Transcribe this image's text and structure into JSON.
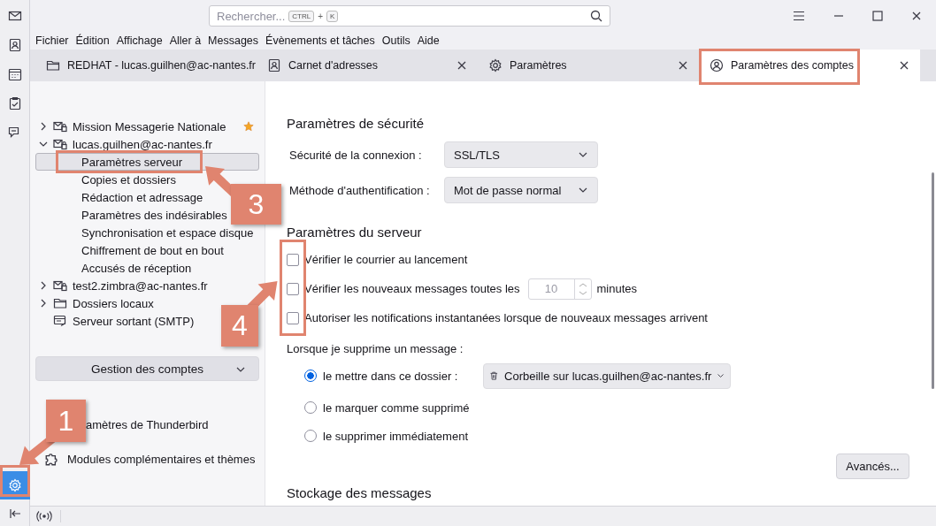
{
  "search": {
    "placeholder": "Rechercher...",
    "keys": [
      "CTRL",
      "+",
      "K"
    ]
  },
  "menu": [
    "Fichier",
    "Édition",
    "Affichage",
    "Aller à",
    "Messages",
    "Évènements et tâches",
    "Outils",
    "Aide"
  ],
  "tabs": [
    {
      "label": "REDHAT - lucas.guilhen@ac-nantes.fr",
      "kind": "folder",
      "closable": false,
      "selected": false
    },
    {
      "label": "Carnet d'adresses",
      "kind": "contacts",
      "closable": true,
      "selected": false
    },
    {
      "label": "Paramètres",
      "kind": "settings",
      "closable": true,
      "selected": false
    },
    {
      "label": "Paramètres des comptes",
      "kind": "account",
      "closable": true,
      "selected": true
    }
  ],
  "accounts": [
    {
      "label": "Mission Messagerie Nationale",
      "kind": "mail",
      "expanded": false,
      "starred": true
    },
    {
      "label": "lucas.guilhen@ac-nantes.fr",
      "kind": "mail",
      "expanded": true,
      "starred": false,
      "children": [
        {
          "label": "Paramètres serveur",
          "selected": true
        },
        {
          "label": "Copies et dossiers",
          "selected": false
        },
        {
          "label": "Rédaction et adressage",
          "selected": false
        },
        {
          "label": "Paramètres des indésirables",
          "selected": false
        },
        {
          "label": "Synchronisation et espace disque",
          "selected": false
        },
        {
          "label": "Chiffrement de bout en bout",
          "selected": false
        },
        {
          "label": "Accusés de réception",
          "selected": false
        }
      ]
    },
    {
      "label": "test2.zimbra@ac-nantes.fr",
      "kind": "mail",
      "expanded": false,
      "starred": false
    },
    {
      "label": "Dossiers locaux",
      "kind": "local",
      "expanded": false,
      "starred": false
    },
    {
      "label": "Serveur sortant (SMTP)",
      "kind": "smtp",
      "starred": false
    }
  ],
  "account_actions": "Gestion des comptes",
  "footer_links": [
    {
      "label": "amètres de Thunderbird",
      "kind": "covered"
    },
    {
      "label": "Modules complémentaires et thèmes",
      "kind": "addons"
    }
  ],
  "security": {
    "title": "Paramètres de sécurité",
    "fields": [
      {
        "label": "Sécurité de la connexion :",
        "value": "SSL/TLS"
      },
      {
        "label": "Méthode d'authentification :",
        "value": "Mot de passe normal"
      }
    ]
  },
  "server": {
    "title": "Paramètres du serveur",
    "options": [
      {
        "label": "Vérifier le courrier au lancement",
        "checked": false
      },
      {
        "label": "Vérifier les nouveaux messages toutes les",
        "checked": false,
        "interval": "10",
        "unit": "minutes"
      },
      {
        "label": "Autoriser les notifications instantanées lorsque de nouveaux messages arrivent",
        "checked": false
      }
    ]
  },
  "delete": {
    "label": "Lorsque je supprime un message :",
    "choices": [
      {
        "label": "le mettre dans ce dossier :",
        "selected": true,
        "folder": "Corbeille sur lucas.guilhen@ac-nantes.fr"
      },
      {
        "label": "le marquer comme supprimé",
        "selected": false
      },
      {
        "label": "le supprimer immédiatement",
        "selected": false
      }
    ]
  },
  "advanced_button": "Avancés...",
  "next_section": "Stockage des messages",
  "annotations": [
    {
      "label": "1"
    },
    {
      "label": "3"
    },
    {
      "label": "4"
    }
  ]
}
